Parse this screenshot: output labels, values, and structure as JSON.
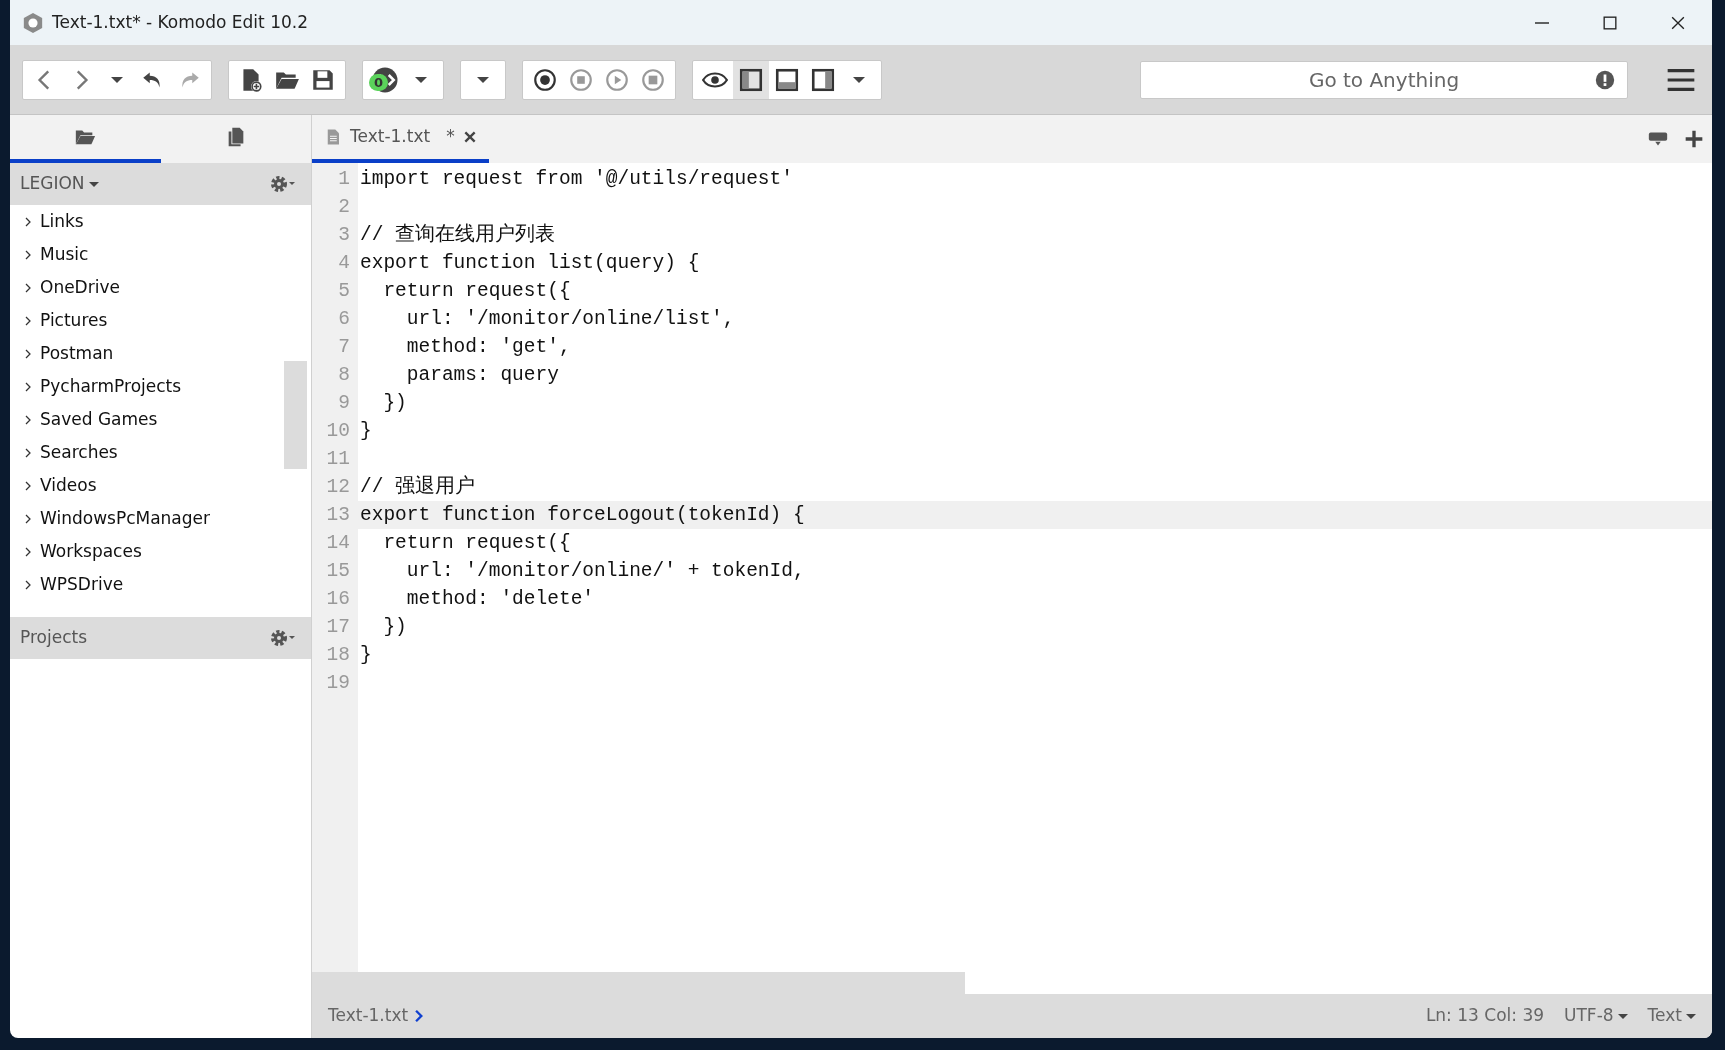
{
  "window": {
    "title": "Text-1.txt* - Komodo Edit 10.2"
  },
  "toolbar": {
    "badge": "0",
    "search": {
      "placeholder": "Go to Anything"
    }
  },
  "side_tabs": [
    {
      "kind": "folder",
      "selected": true
    },
    {
      "kind": "files",
      "selected": false
    }
  ],
  "places": {
    "root": "LEGION",
    "items": [
      {
        "label": "Links",
        "expanded": false
      },
      {
        "label": "Music",
        "expanded": false
      },
      {
        "label": "OneDrive",
        "expanded": false
      },
      {
        "label": "Pictures",
        "expanded": false
      },
      {
        "label": "Postman",
        "expanded": false
      },
      {
        "label": "PycharmProjects",
        "expanded": false
      },
      {
        "label": "Saved Games",
        "expanded": false
      },
      {
        "label": "Searches",
        "expanded": false
      },
      {
        "label": "Videos",
        "expanded": false
      },
      {
        "label": "WindowsPcManager",
        "expanded": false
      },
      {
        "label": "Workspaces",
        "expanded": false
      },
      {
        "label": "WPSDrive",
        "expanded": false
      }
    ]
  },
  "projects": {
    "title": "Projects"
  },
  "editor_tabs": [
    {
      "label": "Text-1.txt",
      "modified": "*",
      "selected": true
    }
  ],
  "code": [
    {
      "number": "1",
      "text": "import request from '@/utils/request'",
      "current": false
    },
    {
      "number": "2",
      "current": false
    },
    {
      "number": "3",
      "text": "// 查询在线用户列表",
      "current": false
    },
    {
      "number": "4",
      "text": "export function list(query) {",
      "current": false
    },
    {
      "number": "5",
      "text": "  return request({",
      "current": false
    },
    {
      "number": "6",
      "text": "    url: '/monitor/online/list',",
      "current": false
    },
    {
      "number": "7",
      "text": "    method: 'get',",
      "current": false
    },
    {
      "number": "8",
      "text": "    params: query",
      "current": false
    },
    {
      "number": "9",
      "text": "  })",
      "current": false
    },
    {
      "number": "10",
      "text": "}",
      "current": false
    },
    {
      "number": "11",
      "current": false
    },
    {
      "number": "12",
      "text": "// 强退用户",
      "current": false
    },
    {
      "number": "13",
      "text": "export function forceLogout(tokenId) {",
      "current": true
    },
    {
      "number": "14",
      "text": "  return request({",
      "current": false
    },
    {
      "number": "15",
      "text": "    url: '/monitor/online/' + tokenId,",
      "current": false
    },
    {
      "number": "16",
      "text": "    method: 'delete'",
      "current": false
    },
    {
      "number": "17",
      "text": "  })",
      "current": false
    },
    {
      "number": "18",
      "text": "}",
      "current": false
    },
    {
      "number": "19",
      "current": false
    }
  ],
  "status_bar": {
    "breadcrumb": "Text-1.txt",
    "position": "Ln: 13 Col: 39",
    "encoding": "UTF-8",
    "language": "Text"
  }
}
